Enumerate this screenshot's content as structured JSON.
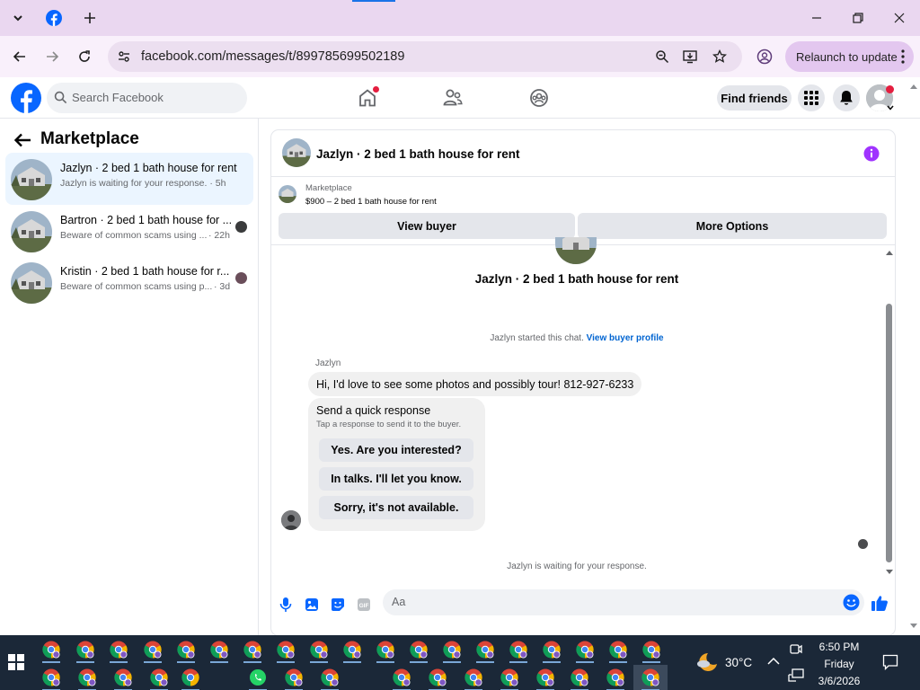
{
  "browser": {
    "address_url": "facebook.com/messages/t/899785699502189",
    "relaunch_label": "Relaunch to update"
  },
  "facebook": {
    "search_placeholder": "Search Facebook",
    "find_friends_label": "Find friends"
  },
  "sidebar": {
    "title": "Marketplace",
    "conversations": [
      {
        "title": "Jazlyn · 2 bed 1 bath house for rent",
        "subtitle": "Jazlyn is waiting for your response. · 5h",
        "time": "",
        "active": true
      },
      {
        "title": "Bartron · 2 bed 1 bath house for ...",
        "subtitle": "Beware of common scams using ...",
        "time": "· 22h",
        "active": false
      },
      {
        "title": "Kristin · 2 bed 1 bath house for r...",
        "subtitle": "Beware of common scams using p...",
        "time": "· 3d",
        "active": false
      }
    ]
  },
  "chat": {
    "header_title": "Jazlyn · 2 bed 1 bath house for rent",
    "marketplace_label": "Marketplace",
    "listing_price": "$900 – 2 bed 1 bath house for rent",
    "view_buyer_label": "View buyer",
    "more_options_label": "More Options",
    "body_title": "Jazlyn · 2 bed 1 bath house for rent",
    "started_text": "Jazlyn started this chat.",
    "view_buyer_profile": "View buyer profile",
    "sender_name": "Jazlyn",
    "message": "Hi, I'd love to see some photos and possibly tour! 812-927-6233",
    "quick_response_title": "Send a quick response",
    "quick_response_subtitle": "Tap a response to send it to the buyer.",
    "quick_responses": [
      "Yes. Are you interested?",
      "In talks. I'll let you know.",
      "Sorry, it's not available."
    ],
    "waiting_text": "Jazlyn is waiting for your response.",
    "composer_placeholder": "Aa"
  },
  "taskbar": {
    "temperature": "30°C",
    "time": "6:50 PM",
    "day": "Friday",
    "date": "3/6/2026"
  },
  "colors": {
    "facebook_blue": "#0866ff",
    "info_purple": "#a033ff",
    "notification_red": "#e41e3f",
    "tabstrip": "#ead7f0"
  }
}
